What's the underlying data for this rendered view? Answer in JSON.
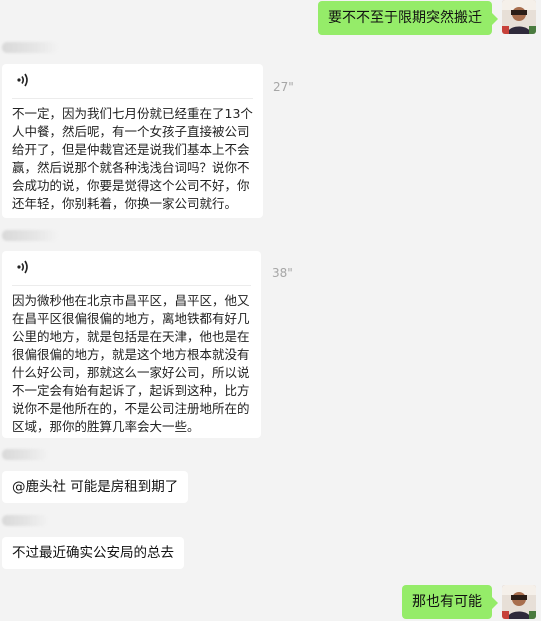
{
  "messages": {
    "m1": {
      "text": "要不不至于限期突然搬迁"
    },
    "m2": {
      "duration": "27\"",
      "transcript": "不一定，因为我们七月份就已经重在了13个人中餐，然后呢，有一个女孩子直接被公司给开了，但是仲裁官还是说我们基本上不会赢，然后说那个就各种浅浅台词吗？说你不会成功的说，你要是觉得这个公司不好，你还年轻，你别耗着，你换一家公司就行。"
    },
    "m3": {
      "duration": "38\"",
      "transcript": "因为微秒他在北京市昌平区，昌平区，他又在昌平区很偏很偏的地方，离地铁都有好几公里的地方，就是包括是在天津，他也是在很偏很偏的地方，就是这个地方根本就没有什么好公司，那就这么一家好公司，所以说不一定会有始有起诉了，起诉到这种，比方说你不是他所在的，不是公司注册地所在的区域，那你的胜算几率会大一些。"
    },
    "m4": {
      "text": "@鹿头社 可能是房租到期了"
    },
    "m5": {
      "text": "不过最近确实公安局的总去"
    },
    "m6": {
      "text": "那也有可能"
    }
  },
  "colors": {
    "outgoing_bubble": "#95ec69",
    "incoming_bubble": "#ffffff",
    "background": "#f3f3f3"
  },
  "icons": {
    "voice": "voice-wave-icon",
    "avatar": "user-avatar"
  }
}
